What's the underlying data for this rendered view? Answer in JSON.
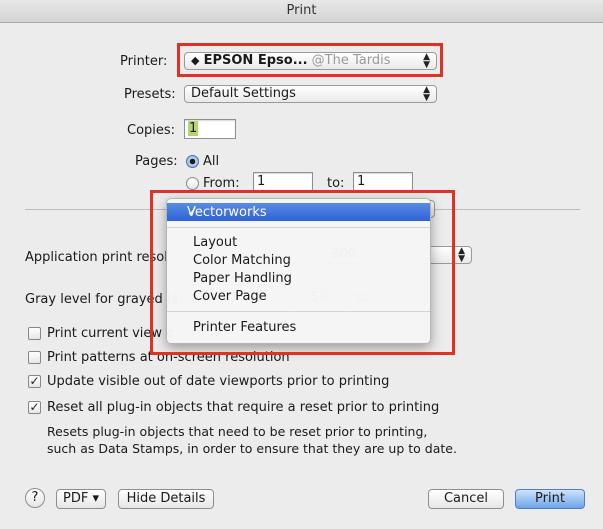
{
  "window": {
    "title": "Print"
  },
  "printer": {
    "label": "Printer:",
    "name": "EPSON Epso...",
    "location": "@The Tardis",
    "icon": "diamond-icon"
  },
  "presets": {
    "label": "Presets:",
    "value": "Default Settings"
  },
  "copies": {
    "label": "Copies:",
    "value": "1"
  },
  "pages": {
    "label": "Pages:",
    "all_label": "All",
    "from_label": "From:",
    "from_value": "1",
    "to_label": "to:",
    "to_value": "1"
  },
  "menu": {
    "selected": "Vectorworks",
    "check_glyph": "✓",
    "group1": [
      "Layout",
      "Color Matching",
      "Paper Handling",
      "Cover Page"
    ],
    "group2": [
      "Printer Features"
    ]
  },
  "options": {
    "resolution_label": "Application print resol",
    "resolution_value": "300",
    "gray_label": "Gray level for grayed la",
    "gray_value": "50",
    "gray_unit": "%",
    "checkboxes": [
      {
        "label": "Print current view o",
        "checked": false
      },
      {
        "label": "Print patterns at on-screen resolution",
        "checked": false
      },
      {
        "label": "Update visible out of date viewports prior to printing",
        "checked": true
      },
      {
        "label": "Reset all plug-in objects that require a reset prior to printing",
        "checked": true
      }
    ],
    "reset_note_line1": "Resets plug-in objects that need to be reset prior to printing,",
    "reset_note_line2": "such as Data Stamps, in order to ensure that they are up to date."
  },
  "footer": {
    "help": "?",
    "pdf": "PDF ▾",
    "hide_details": "Hide Details",
    "cancel": "Cancel",
    "print": "Print"
  },
  "colors": {
    "highlight": "#e03126",
    "selection": "#3a6bd9",
    "primary_button": "#6ea4ea"
  }
}
